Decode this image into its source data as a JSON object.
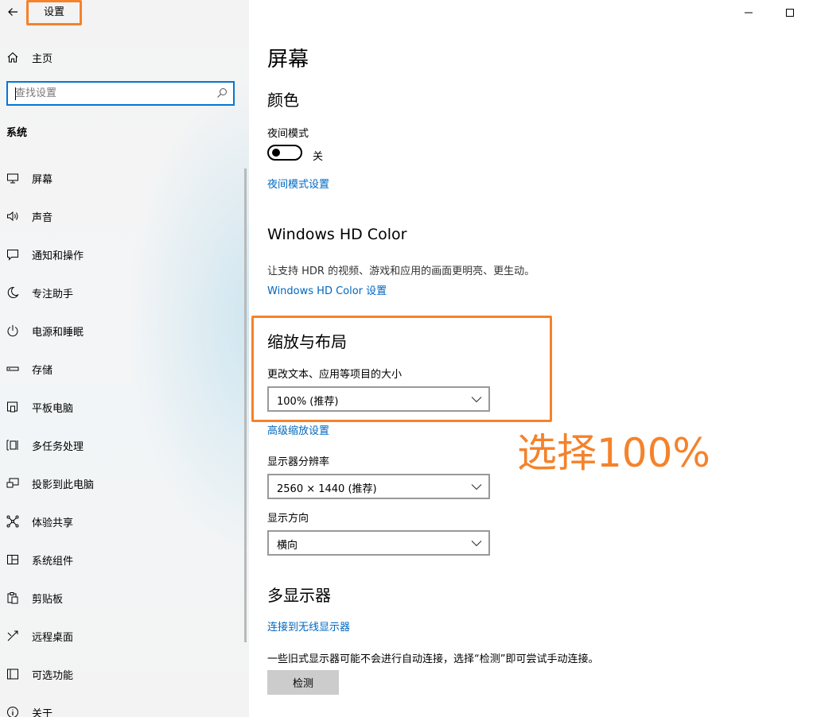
{
  "app": {
    "title": "设置"
  },
  "sidebar": {
    "home_label": "主页",
    "search_placeholder": "查找设置",
    "section_label": "系统",
    "items": [
      {
        "label": "屏幕",
        "icon": "monitor-icon"
      },
      {
        "label": "声音",
        "icon": "speaker-icon"
      },
      {
        "label": "通知和操作",
        "icon": "notification-icon"
      },
      {
        "label": "专注助手",
        "icon": "moon-icon"
      },
      {
        "label": "电源和睡眠",
        "icon": "power-icon"
      },
      {
        "label": "存储",
        "icon": "storage-icon"
      },
      {
        "label": "平板电脑",
        "icon": "tablet-icon"
      },
      {
        "label": "多任务处理",
        "icon": "multitask-icon"
      },
      {
        "label": "投影到此电脑",
        "icon": "project-icon"
      },
      {
        "label": "体验共享",
        "icon": "share-icon"
      },
      {
        "label": "系统组件",
        "icon": "components-icon"
      },
      {
        "label": "剪贴板",
        "icon": "clipboard-icon"
      },
      {
        "label": "远程桌面",
        "icon": "remote-icon"
      },
      {
        "label": "可选功能",
        "icon": "optional-features-icon"
      },
      {
        "label": "关于",
        "icon": "info-icon"
      }
    ]
  },
  "main": {
    "page_title": "屏幕",
    "color_heading": "颜色",
    "night_mode_label": "夜间模式",
    "night_mode_state": "关",
    "night_mode_link": "夜间模式设置",
    "hdr_heading": "Windows HD Color",
    "hdr_desc": "让支持 HDR 的视频、游戏和应用的画面更明亮、更生动。",
    "hdr_link": "Windows HD Color 设置",
    "scale_heading": "缩放与布局",
    "scale_label": "更改文本、应用等项目的大小",
    "scale_value": "100% (推荐)",
    "advanced_scale_link": "高级缩放设置",
    "resolution_label": "显示器分辨率",
    "resolution_value": "2560 × 1440 (推荐)",
    "orientation_label": "显示方向",
    "orientation_value": "横向",
    "multi_display_heading": "多显示器",
    "wireless_link": "连接到无线显示器",
    "detect_desc": "一些旧式显示器可能不会进行自动连接，选择“检测”即可尝试手动连接。",
    "detect_button": "检测"
  },
  "annotation": {
    "text": "选择100%",
    "color": "#f5822a"
  },
  "colors": {
    "accent": "#0078d7",
    "link": "#0067c0",
    "annotation": "#f5822a"
  }
}
